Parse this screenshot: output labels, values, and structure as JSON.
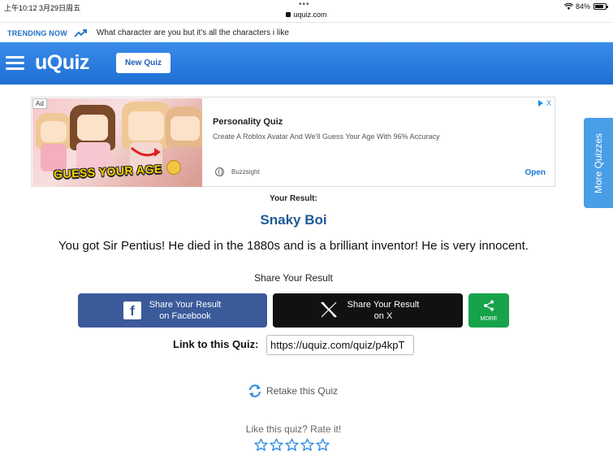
{
  "status_bar": {
    "time": "上午10:12",
    "date": "3月29日周五",
    "url": "uquiz.com",
    "battery_percent": "84%",
    "battery_level": 0.84
  },
  "trending": {
    "label": "TRENDING NOW",
    "icon": "trending-up-icon",
    "text": "What character are you but it's all the characters i like"
  },
  "header": {
    "menu_icon": "hamburger-icon",
    "logo": "uQuiz",
    "new_quiz_label": "New Quiz",
    "brand_color": "#2a7fe0"
  },
  "ad": {
    "badge": "Ad",
    "image_text": "GUESS YOUR AGE",
    "title": "Personality Quiz",
    "description": "Create A Roblox Avatar And We'll Guess Your Age With 96% Accuracy",
    "advertiser": "Buzzsight",
    "cta": "Open",
    "close_symbol": "X"
  },
  "side_tab": {
    "label": "More Quizzes"
  },
  "result": {
    "heading": "Your Result:",
    "title": "Snaky Boi",
    "description": "You got Sir Pentius! He died in the 1880s and is a brilliant inventor! He is very innocent."
  },
  "share": {
    "heading": "Share Your Result",
    "facebook": {
      "line1": "Share Your Result",
      "line2": "on Facebook",
      "color": "#3b5a9a"
    },
    "x": {
      "line1": "Share Your Result",
      "line2": "on X",
      "color": "#111111"
    },
    "more": {
      "label": "MORE",
      "color": "#16a34a"
    }
  },
  "link": {
    "label": "Link to this Quiz:",
    "value": "https://uquiz.com/quiz/p4kpT"
  },
  "retake": {
    "label": "Retake this Quiz"
  },
  "rating": {
    "label": "Like this quiz? Rate it!",
    "max_stars": 5,
    "selected": 0
  }
}
